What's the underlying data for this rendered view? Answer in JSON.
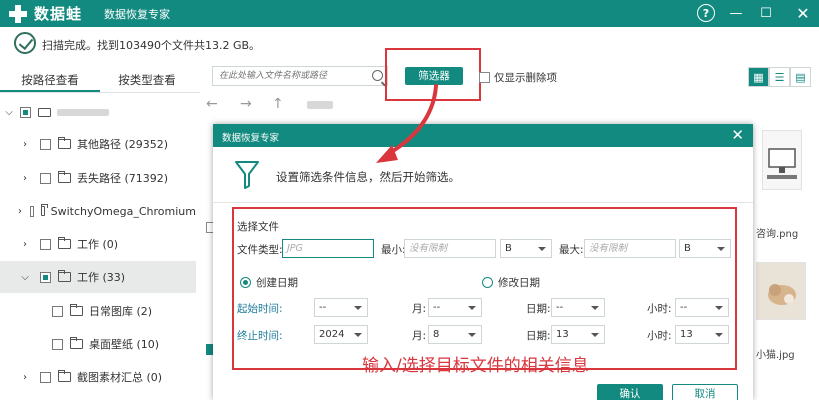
{
  "titlebar": {
    "logo_text": "数据蛙",
    "subtitle": "数据恢复专家",
    "help": "?",
    "minimize": "—",
    "maximize": "☐",
    "close": "✕"
  },
  "status": {
    "text": "扫描完成。找到103490个文件共13.2 GB。"
  },
  "tabs": {
    "by_path": "按路径查看",
    "by_type": "按类型查看"
  },
  "toolbar": {
    "search_placeholder": "在此处输入文件名称或路径",
    "filter_label": "筛选器",
    "show_deleted": "仅显示删除项"
  },
  "nav": {
    "back": "←",
    "forward": "→",
    "up": "↑"
  },
  "tree": [
    {
      "label": "其他路径 (29352)"
    },
    {
      "label": "丢失路径 (71392)"
    },
    {
      "label": "SwitchyOmega_Chromium"
    },
    {
      "label": "工作 (0)"
    },
    {
      "label": "工作 (33)"
    },
    {
      "label": "日常图库 (2)"
    },
    {
      "label": "桌面壁纸 (10)"
    },
    {
      "label": "截图素材汇总 (0)"
    }
  ],
  "background": {
    "file1": "咨询.png",
    "file2": "小猫.jpg"
  },
  "dialog": {
    "title": "数据恢复专家",
    "close": "✕",
    "info": "设置筛选条件信息，然后开始筛选。",
    "section_title": "选择文件",
    "file_type_label": "文件类型:",
    "file_type_placeholder": "JPG",
    "min_label": "最小:",
    "min_placeholder": "没有限制",
    "min_unit": "B",
    "max_label": "最大:",
    "max_placeholder": "没有限制",
    "max_unit": "B",
    "created_date": "创建日期",
    "modified_date": "修改日期",
    "start_label": "起始时间:",
    "end_label": "终止时间:",
    "month_label": "月:",
    "day_label": "日期:",
    "hour_label": "小时:",
    "start": {
      "year": "--",
      "month": "--",
      "day": "--",
      "hour": "--"
    },
    "end": {
      "year": "2024",
      "month": "8",
      "day": "13",
      "hour": "13"
    },
    "annotation": "输入/选择目标文件的相关信息",
    "ok": "确认",
    "cancel": "取消"
  }
}
